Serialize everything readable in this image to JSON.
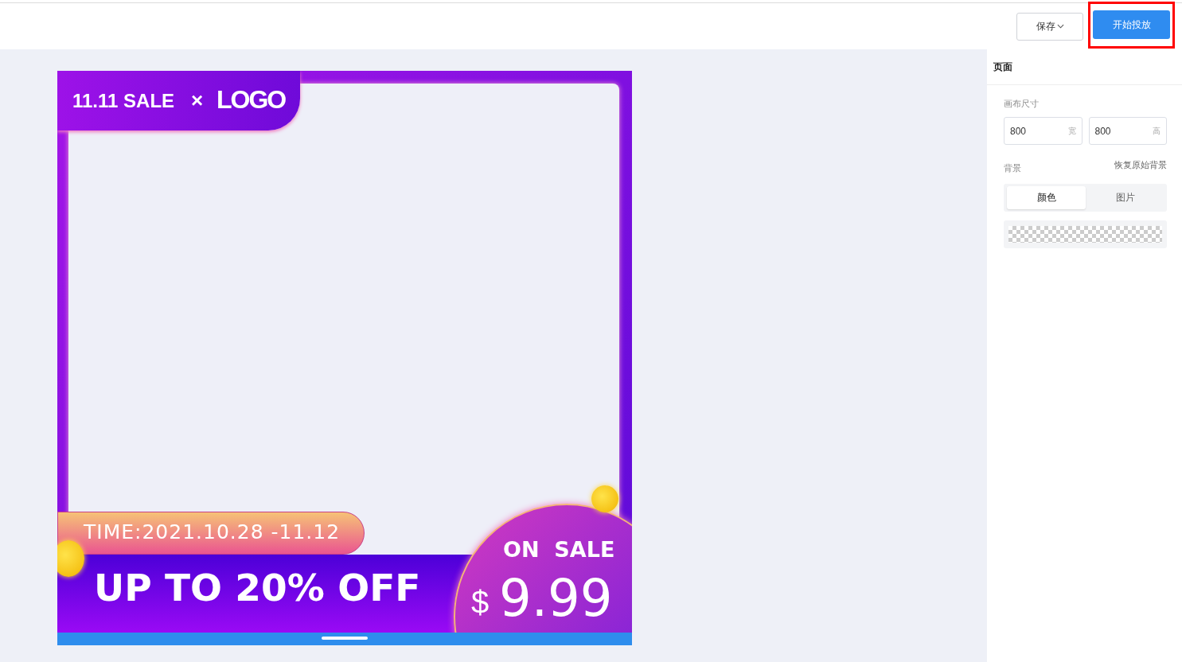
{
  "toolbar": {
    "buttons": [
      {
        "label": "保存",
        "kind": "dropdown",
        "highlighted": false
      },
      {
        "label": "开始投放",
        "kind": "primary",
        "highlighted": true
      }
    ]
  },
  "poster": {
    "header": {
      "sale": "11.11 SALE",
      "times": "×",
      "logo": "LOGO"
    },
    "date": "TIME:2021.10.28 -11.12",
    "headline": "UP TO 20% OFF",
    "badge": {
      "title": "ON  SALE",
      "currency": "$",
      "price": "9.99"
    }
  },
  "panel": {
    "title": "页面",
    "size_label": "画布尺寸",
    "fields": [
      {
        "value": "800",
        "unit": "宽"
      },
      {
        "value": "800",
        "unit": "高"
      }
    ],
    "background_label": "背景",
    "reset_link": "恢复原始背景",
    "tabs": [
      {
        "label": "颜色",
        "selected": true
      },
      {
        "label": "图片",
        "selected": false
      }
    ]
  }
}
